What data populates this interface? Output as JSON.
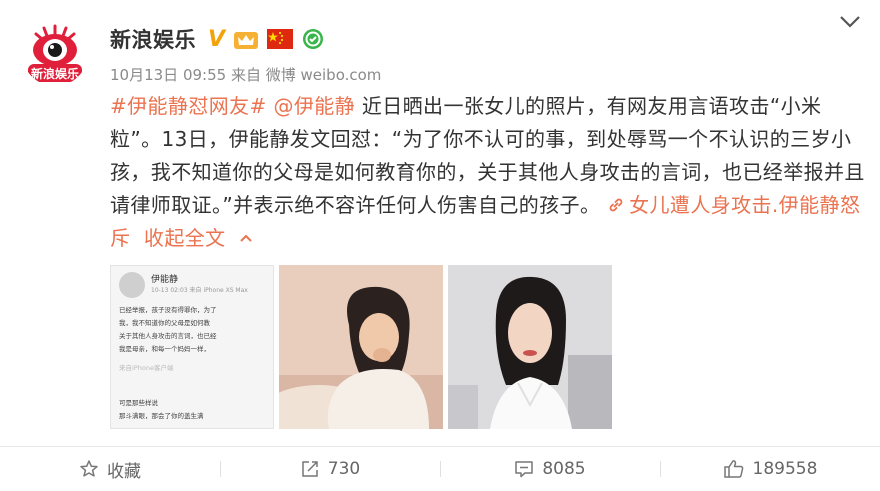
{
  "post": {
    "author": "新浪娱乐",
    "verified_icon": "verified-v-icon",
    "avatar_text": "新浪娱乐",
    "time": "10月13日 09:55",
    "from_prefix": "来自",
    "source": "微博 weibo.com",
    "content": {
      "hashtag": "#伊能静怼网友#",
      "mention": "@伊能静",
      "body": " 近日晒出一张女儿的照片，有网友用言语攻击“小米粒”。13日，伊能静发文回怼：“为了你不认可的事，到处辱骂一个不认识的三岁小孩，我不知道你的父母是如何教育你的，关于其他人身攻击的言词，也已经举报并且请律师取证。”并表示绝不容许任何人伤害自己的孩子。 ",
      "link_label": "女儿遭人身攻击.伊能静怒斥",
      "collapse_label": "收起全文"
    },
    "screenshot": {
      "username": "伊能静",
      "device": "10-13 02:03 来自 iPhone XS Max",
      "lines": [
        "已经举报，孩子没有得罪你，为了",
        "我，我不知道你的父母是如何教",
        "关于其他人身攻击的言词，也已经",
        "我是母亲，和每一个妈妈一样，",
        "来自iPhone客户端",
        "可是那些样说",
        "那斗满眼，那会了你的盖生满"
      ]
    }
  },
  "actions": {
    "favorite_label": "收藏",
    "repost_count": "730",
    "comment_count": "8085",
    "like_count": "189558"
  },
  "colors": {
    "link": "#eb7350",
    "text": "#333333",
    "meta": "#8a8a8a"
  }
}
